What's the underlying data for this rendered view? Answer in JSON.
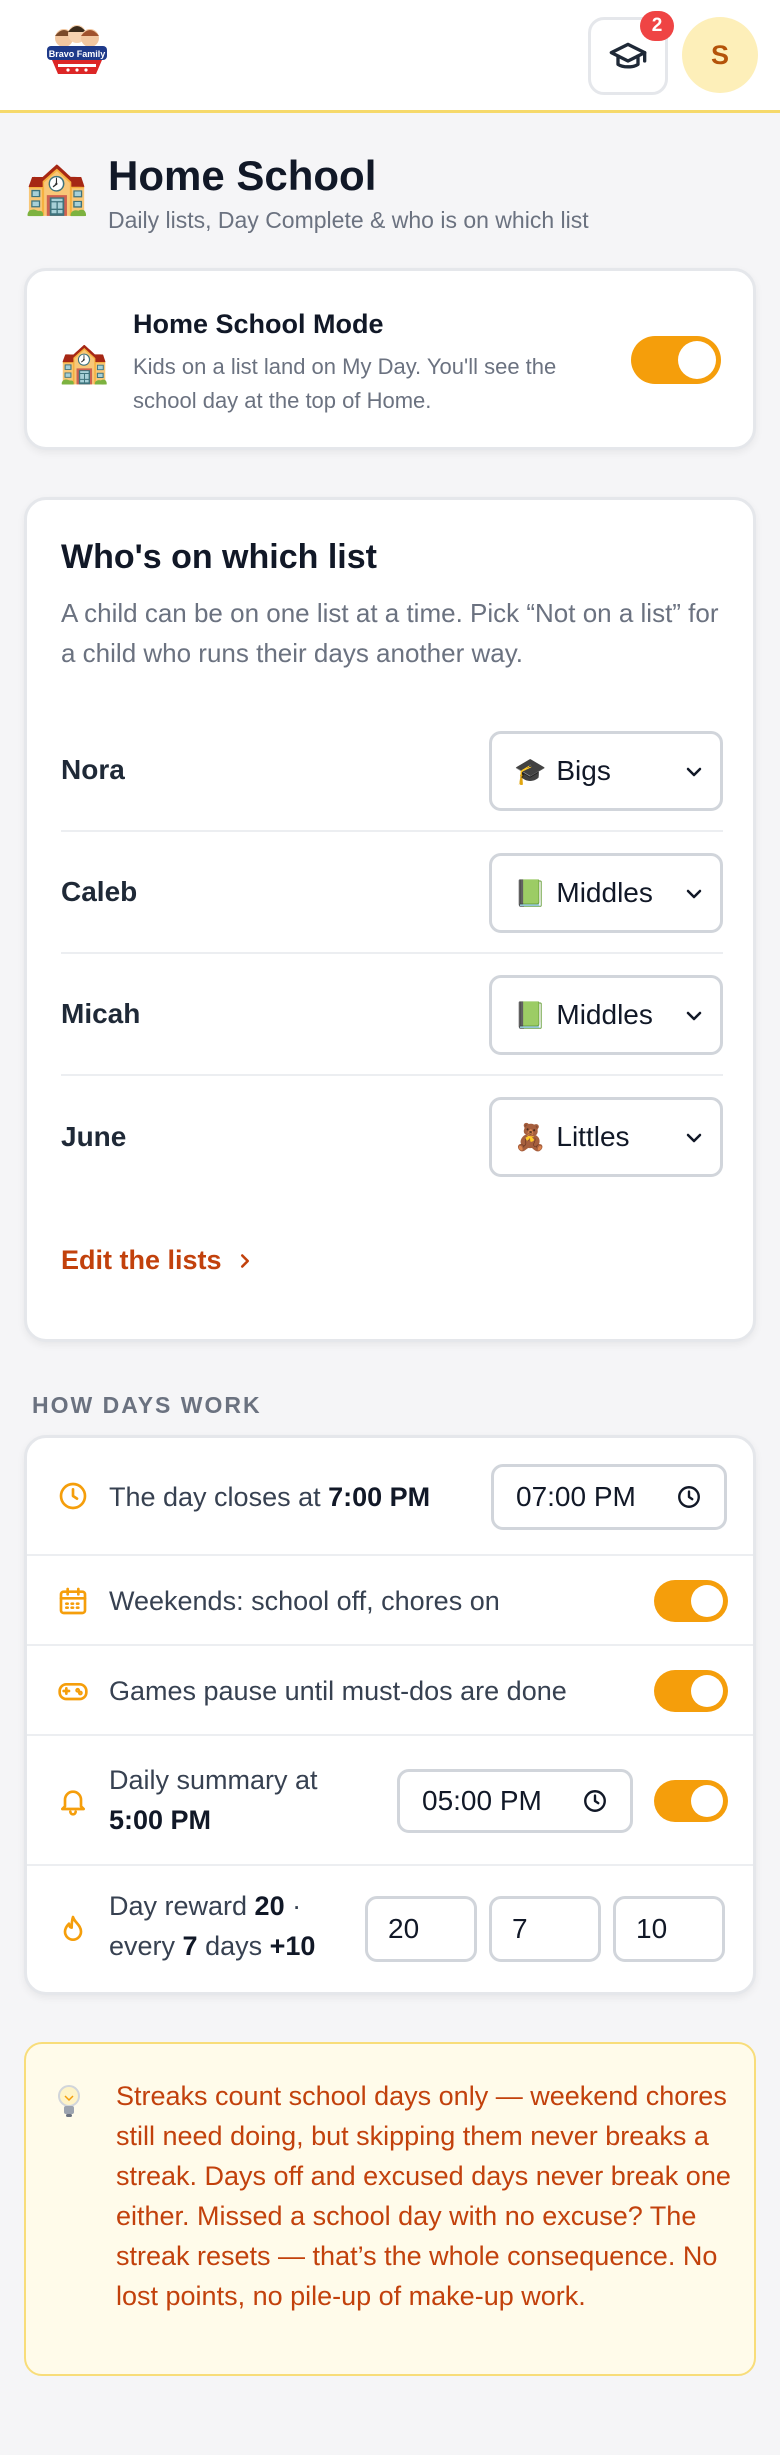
{
  "header": {
    "logo_text": "Bravo Family",
    "notification_count": "2",
    "avatar_initial": "S"
  },
  "page": {
    "emoji": "🏫",
    "title": "Home School",
    "subtitle": "Daily lists, Day Complete & who is on which list"
  },
  "home_school_mode": {
    "emoji": "🏫",
    "title": "Home School Mode",
    "description": "Kids on a list land on My Day. You'll see the school day at the top of Home.",
    "enabled": true
  },
  "lists_card": {
    "title": "Who's on which list",
    "description": "A child can be on one list at a time. Pick “Not on a list” for a child who runs their days another way.",
    "children": [
      {
        "name": "Nora",
        "list_icon": "🎓",
        "list": "Bigs"
      },
      {
        "name": "Caleb",
        "list_icon": "📗",
        "list": "Middles"
      },
      {
        "name": "Micah",
        "list_icon": "📗",
        "list": "Middles"
      },
      {
        "name": "June",
        "list_icon": "🧸",
        "list": "Littles"
      }
    ],
    "edit_link": "Edit the lists"
  },
  "how_days_work": {
    "heading": "HOW DAYS WORK",
    "day_closes": {
      "prefix": "The day closes at ",
      "time_bold": "7:00 PM",
      "input_value": "07:00 PM"
    },
    "weekends": {
      "label": "Weekends: school off, chores on",
      "enabled": true
    },
    "games_pause": {
      "label": "Games pause until must-dos are done",
      "enabled": true
    },
    "daily_summary": {
      "prefix": "Daily summary at",
      "time_bold": "5:00 PM",
      "input_value": "05:00 PM",
      "enabled": true
    },
    "day_reward": {
      "t1": "Day reward ",
      "points": "20",
      "t2": " ·",
      "t3": "every ",
      "days": "7",
      "t4": " days ",
      "bonus": "+10",
      "inputs": [
        "20",
        "7",
        "10"
      ]
    }
  },
  "note": {
    "text": "Streaks count school days only — weekend chores still need doing, but skipping them never breaks a streak. Days off and excused days never break one either. Missed a school day with no excuse? The streak resets — that’s the whole consequence. No lost points, no pile-up of make-up work."
  },
  "colors": {
    "accent": "#f59e0b",
    "link": "#c2410c",
    "note_bg": "#fffbea",
    "badge": "#ef4444"
  }
}
